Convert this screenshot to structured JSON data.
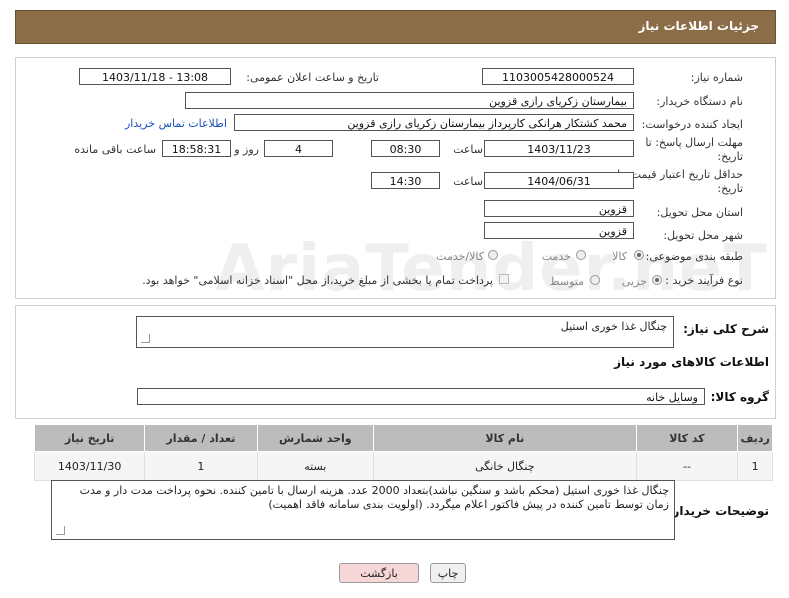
{
  "header": {
    "title": "جزئیات اطلاعات نیاز"
  },
  "fields": {
    "need_number_label": "شماره نیاز:",
    "need_number": "1103005428000524",
    "announce_label": "تاریخ و ساعت اعلان عمومی:",
    "announce_value": "1403/11/18 - 13:08",
    "buyer_org_label": "نام دستگاه خریدار:",
    "buyer_org": "بیمارستان زکریای رازی قزوین",
    "creator_label": "ایجاد کننده درخواست:",
    "creator": "محمد کشتکار هرانکی کارپرداز بیمارستان زکریای رازی قزوین",
    "contact_link": "اطلاعات تماس خریدار",
    "reply_deadline_label_1": "مهلت ارسال پاسخ: تا",
    "reply_deadline_label_2": "تاریخ:",
    "reply_date": "1403/11/23",
    "time_label": "ساعت",
    "reply_time": "08:30",
    "days": "4",
    "days_label": "روز و",
    "remaining": "18:58:31",
    "remaining_label": "ساعت باقی مانده",
    "price_validity_label_1": "حداقل تاریخ اعتبار قیمت: تا",
    "price_validity_label_2": "تاریخ:",
    "price_date": "1404/06/31",
    "price_time_label": "ساعت",
    "price_time": "14:30",
    "province_label": "استان محل تحویل:",
    "province": "قزوین",
    "city_label": "شهر محل تحویل:",
    "city": "قزوین",
    "category_label": "طبقه بندی موضوعی:",
    "category_options": [
      "کالا",
      "خدمت",
      "کالا/خدمت"
    ],
    "category_selected": "کالا",
    "process_label": "نوع فرآیند خرید :",
    "process_options": [
      "جزیی",
      "متوسط"
    ],
    "process_selected": "جزیی",
    "payment_note": "پرداخت تمام یا بخشی از مبلغ خرید،از محل \"اسناد خزانه اسلامی\" خواهد بود."
  },
  "summary": {
    "label": "شرح کلی نیاز:",
    "value": "چنگال غذا خوری استیل"
  },
  "goods_section": {
    "title": "اطلاعات کالاهای مورد نیاز",
    "group_label": "گروه کالا:",
    "group_value": "وسایل خانه"
  },
  "table": {
    "columns": [
      "ردیف",
      "کد کالا",
      "نام کالا",
      "واحد شمارش",
      "تعداد / مقدار",
      "تاریخ نیاز"
    ],
    "rows": [
      [
        "1",
        "--",
        "چنگال خانگی",
        "بسته",
        "1",
        "1403/11/30"
      ]
    ]
  },
  "buyer_notes": {
    "label": "توضیحات خریدار:",
    "text": "چنگال غذا خوری استیل (محکم باشد و سنگین نباشد)بتعداد 2000 عدد. هزینه ارسال با تامین کننده. نحوه پرداخت مدت دار و مدت زمان توسط تامین کننده در پیش فاکتور اعلام میگردد. (اولویت بندی سامانه فاقد اهمیت)"
  },
  "buttons": {
    "print": "چاپ",
    "back": "بازگشت"
  },
  "watermark": "AriaTender.neT",
  "colors": {
    "header": "#8b6d47",
    "link": "#1a4fb8",
    "table_header": "#bcbcbc",
    "back_button": "#f6d6d6"
  }
}
